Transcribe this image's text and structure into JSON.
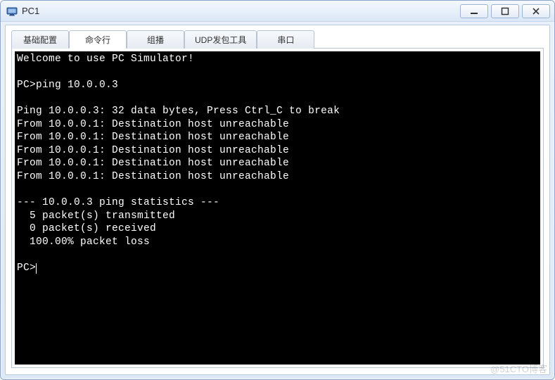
{
  "window": {
    "title": "PC1"
  },
  "tabs": {
    "items": [
      {
        "label": "基础配置"
      },
      {
        "label": "命令行"
      },
      {
        "label": "组播"
      },
      {
        "label": "UDP发包工具"
      },
      {
        "label": "串口"
      }
    ],
    "active_index": 1
  },
  "terminal": {
    "lines": [
      "Welcome to use PC Simulator!",
      "",
      "PC>ping 10.0.0.3",
      "",
      "Ping 10.0.0.3: 32 data bytes, Press Ctrl_C to break",
      "From 10.0.0.1: Destination host unreachable",
      "From 10.0.0.1: Destination host unreachable",
      "From 10.0.0.1: Destination host unreachable",
      "From 10.0.0.1: Destination host unreachable",
      "From 10.0.0.1: Destination host unreachable",
      "",
      "--- 10.0.0.3 ping statistics ---",
      "  5 packet(s) transmitted",
      "  0 packet(s) received",
      "  100.00% packet loss",
      ""
    ],
    "prompt": "PC>"
  },
  "watermark": "@51CTO博客"
}
